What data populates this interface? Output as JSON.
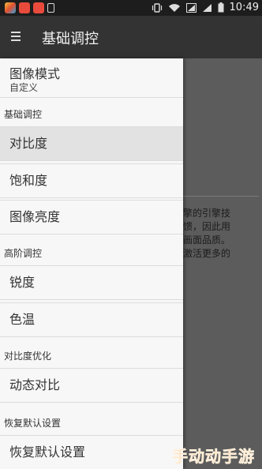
{
  "status_bar": {
    "time": "10:49",
    "icons": [
      "app-icon-1",
      "app-icon-2",
      "app-icon-3",
      "sim-icon",
      "vibrate-icon",
      "wifi-icon",
      "signal-icon",
      "battery-icon"
    ]
  },
  "action_bar": {
    "menu_icon": "hamburger-icon",
    "title": "基础调控"
  },
  "drawer": {
    "mode": {
      "title": "图像模式",
      "value": "自定义"
    },
    "sections": [
      {
        "header": "基础调控",
        "items": [
          "对比度",
          "饱和度",
          "图像亮度"
        ]
      },
      {
        "header": "高阶调控",
        "items": [
          "锐度",
          "色温"
        ]
      },
      {
        "header": "对比度优化",
        "items": [
          "动态对比"
        ]
      },
      {
        "header": "恢复默认设置",
        "items": [
          "恢复默认设置"
        ]
      }
    ],
    "selected_item": "对比度"
  },
  "background": {
    "lines": [
      "擎的引擎技",
      "馈，因此用",
      "画面品质。",
      "激活更多的"
    ]
  },
  "watermark": {
    "text": "手动动手游"
  },
  "colors": {
    "status_bar": "#1d1d1d",
    "action_bar": "#333333",
    "drawer": "#f7f7f7",
    "watermark": "#f07a1c"
  }
}
